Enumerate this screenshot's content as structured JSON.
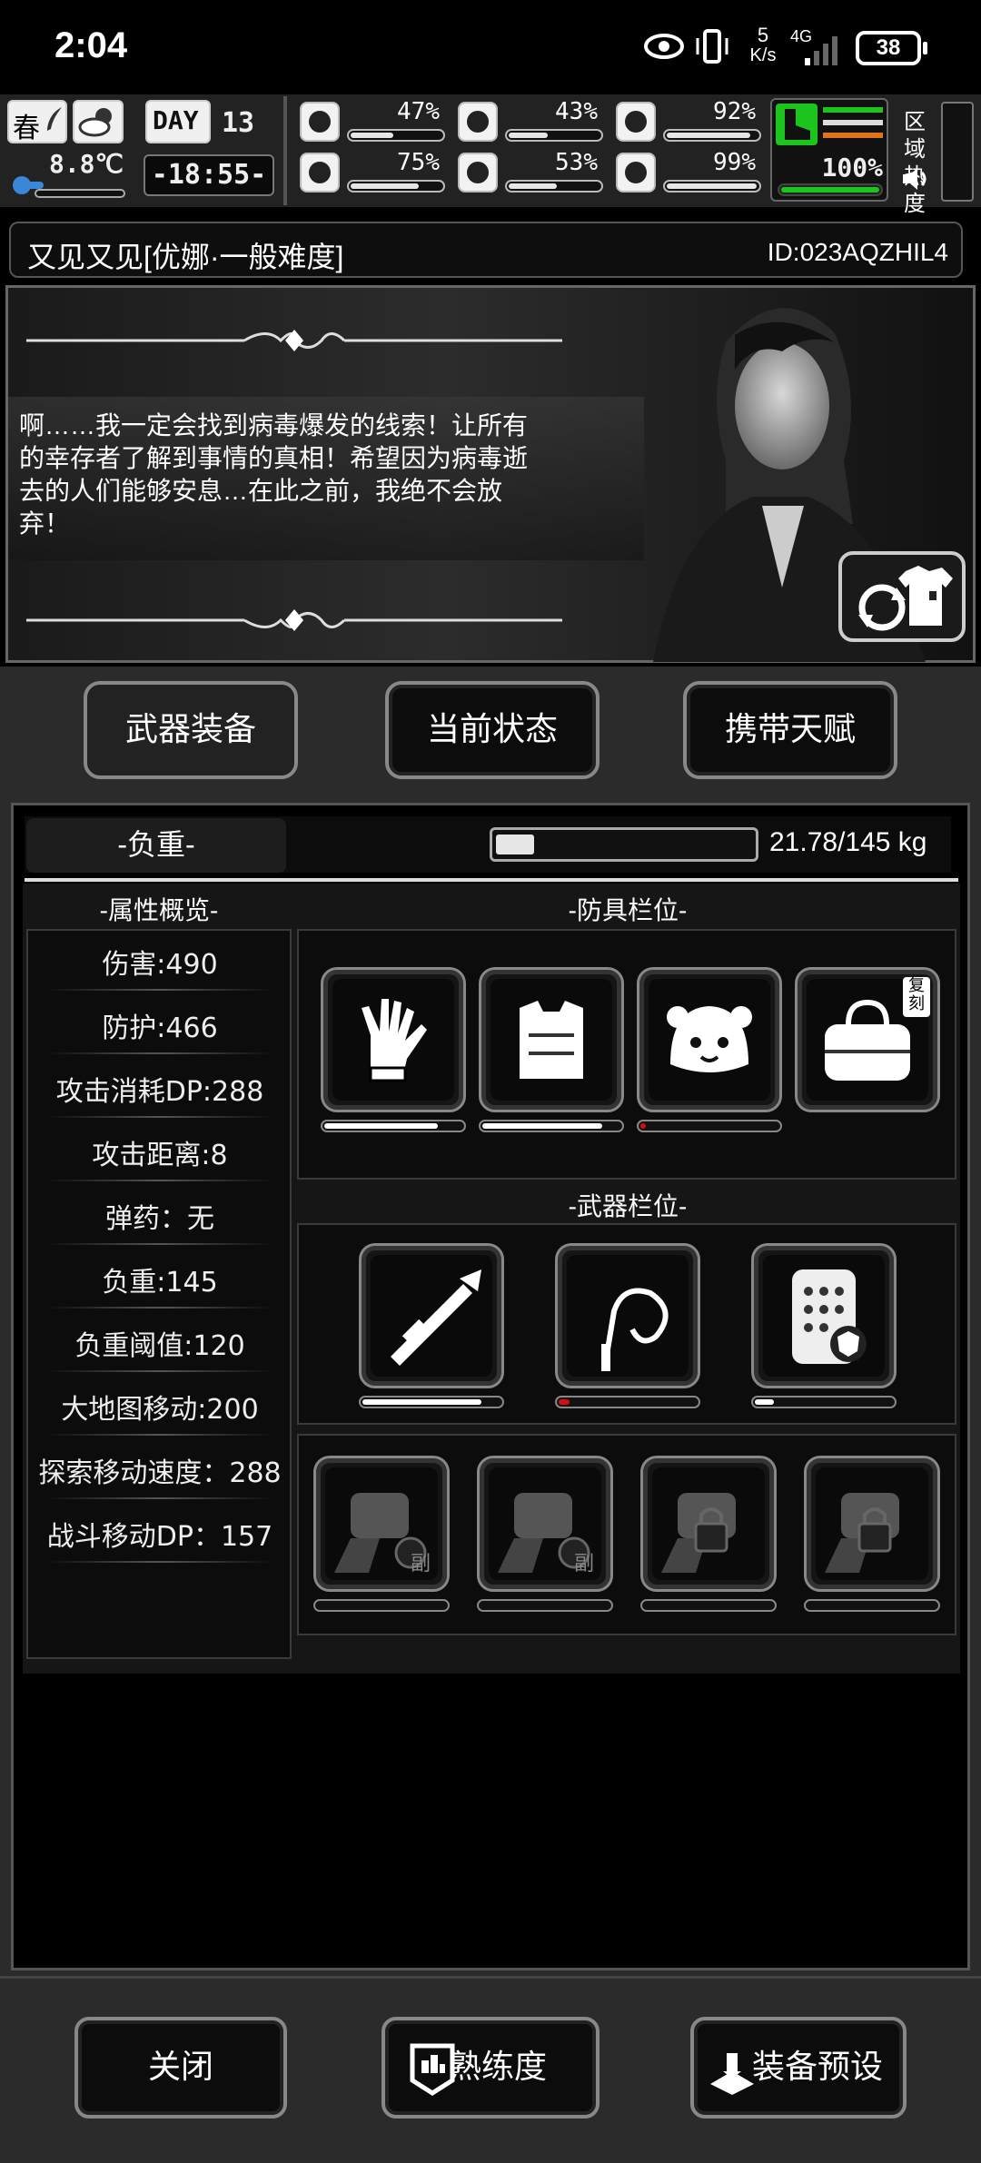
{
  "status_bar": {
    "time": "2:04",
    "net_speed_value": "5",
    "net_speed_unit": "K/s",
    "network": "4G",
    "battery": "38"
  },
  "hud": {
    "season": "春",
    "temperature": "8.8℃",
    "day_label": "DAY",
    "day_value": "13",
    "clock": "-18:55-",
    "stats": [
      {
        "icon": "medkit-icon",
        "value": "47%",
        "level": 0.47
      },
      {
        "icon": "stomach-icon",
        "value": "43%",
        "level": 0.43
      },
      {
        "icon": "pill-icon",
        "value": "92%",
        "level": 0.92
      },
      {
        "icon": "brain-icon",
        "value": "75%",
        "level": 0.75
      },
      {
        "icon": "water-drop-icon",
        "value": "53%",
        "level": 0.53
      },
      {
        "icon": "heart-icon",
        "value": "99%",
        "level": 0.99
      }
    ],
    "stamina_value": "100%",
    "stamina_level": 1.0,
    "region_heat_label": "区域热度"
  },
  "profile": {
    "name_title": "又见又见[优娜·一般难度]",
    "id": "ID:023AQZHIL4",
    "quote": "啊……我一定会找到病毒爆发的线索！让所有的幸存者了解到事情的真相！希望因为病毒逝去的人们能够安息…在此之前，我绝不会放弃！"
  },
  "tabs": [
    "武器装备",
    "当前状态",
    "携带天赋"
  ],
  "load": {
    "label": "-负重-",
    "value": "21.78/145 kg",
    "level": 0.15
  },
  "attributes": {
    "title": "-属性概览-",
    "items": [
      "伤害:490",
      "防护:466",
      "攻击消耗DP:288",
      "攻击距离:8",
      "弹药：无",
      "负重:145",
      "负重阈值:120",
      "大地图移动:200",
      "探索移动速度：288",
      "战斗移动DP：157"
    ]
  },
  "armor": {
    "title": "-防具栏位-",
    "slots": [
      {
        "name": "gloves",
        "durability": 0.82,
        "color": "#ffffff"
      },
      {
        "name": "vest",
        "durability": 0.87,
        "color": "#ffffff"
      },
      {
        "name": "hat",
        "durability": 0.04,
        "color": "#d11010"
      },
      {
        "name": "bag",
        "badge": "复刻",
        "durability": null,
        "color": "#ffffff"
      }
    ]
  },
  "weapons": {
    "title": "-武器栏位-",
    "slots": [
      {
        "name": "rocket-launcher",
        "durability": 0.86,
        "color": "#ffffff"
      },
      {
        "name": "whip",
        "durability": 0.08,
        "color": "#d11010"
      },
      {
        "name": "riot-shield",
        "durability": 0.14,
        "color": "#ffffff"
      }
    ],
    "sub_label": "副"
  },
  "bottom_buttons": [
    "关闭",
    "熟练度",
    "装备预设"
  ]
}
